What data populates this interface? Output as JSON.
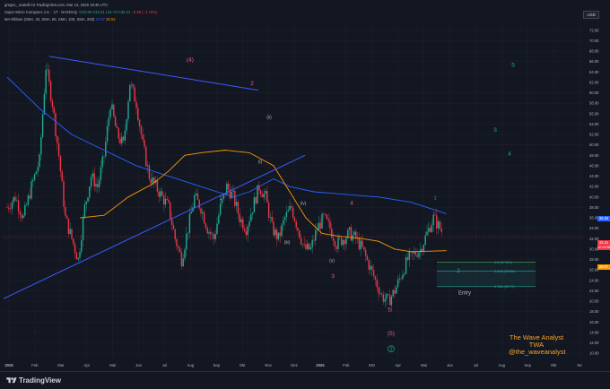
{
  "header": {
    "line1": "gregsc_ aratelli int TradingView.com, Mar 13, 2026 18:46 UTC",
    "symbol": "Super Micro Computer, Inc. · 1T · NASDAQ",
    "ohlc_o": "O32.90",
    "ohlc_h": "H33.21",
    "ohlc_l": "L31.73",
    "ohlc_c": "C32.41",
    "change": "−0.58 (−1.76%)",
    "ma_label": "MA Ribbon (SMA, 20, SMA, 50, SMA, 100, SMA, 200)",
    "ma_v1": "37.87",
    "ma_v2": "30.52"
  },
  "currency": "USD",
  "footer": {
    "brand": "TradingView"
  },
  "watermark": {
    "line1": "The Wave Analyst",
    "line2": "TWA",
    "line3": "@the_waveanalyst"
  },
  "price_labels": {
    "ma_blue": "36.83",
    "last": "32.41",
    "last_sub": "12:13:28",
    "ma_orange": "29.67"
  },
  "fib_labels": [
    "0.5 (27.5%)",
    "0.618 (25.83)",
    "0.786 (22.77)"
  ],
  "entry_label": "Entry",
  "wave_labels": [
    "(4)",
    "2",
    "(ii)",
    "(i)",
    "(iii)",
    "(iv)",
    "(v)",
    "1",
    "4",
    "3",
    "5",
    "(5)",
    "2",
    "1",
    "2",
    "3",
    "4",
    "5"
  ],
  "colors": {
    "bg": "#131722",
    "up": "#22ab94",
    "down": "#f23645",
    "ma_blue": "#2962ff",
    "ma_orange": "#ff9800",
    "label_pink": "#e85a9a",
    "label_teal": "#26a69a",
    "label_white": "#b2b5be",
    "watermark": "#f5a623"
  },
  "chart_data": {
    "type": "candlestick",
    "y_axis_labels": [
      "72.00",
      "70.00",
      "68.00",
      "66.00",
      "64.00",
      "62.00",
      "60.00",
      "58.00",
      "56.00",
      "54.00",
      "52.00",
      "50.00",
      "48.00",
      "46.00",
      "44.00",
      "42.00",
      "40.00",
      "38.00",
      "36.00",
      "34.00",
      "32.00",
      "30.00",
      "28.00",
      "26.00",
      "24.00",
      "22.00",
      "20.00",
      "18.00",
      "16.00",
      "14.00",
      "12.00",
      "10.00"
    ],
    "x_axis_labels": [
      "2025",
      "Feb",
      "Mar",
      "Apr",
      "Mai",
      "Jun",
      "Jul",
      "Aug",
      "Sep",
      "Okt",
      "Nov",
      "Dez",
      "2026",
      "Feb",
      "Mrz",
      "Apr",
      "Mai",
      "Jun",
      "Jul",
      "Aug",
      "Sep",
      "Okt",
      "Nv"
    ],
    "ylim": [
      9,
      73
    ],
    "ohlc_path": [
      [
        0,
        38
      ],
      [
        5,
        40
      ],
      [
        10,
        36
      ],
      [
        15,
        42
      ],
      [
        20,
        47
      ],
      [
        24,
        65
      ],
      [
        28,
        58
      ],
      [
        32,
        48
      ],
      [
        36,
        36
      ],
      [
        40,
        32
      ],
      [
        44,
        28
      ],
      [
        48,
        38
      ],
      [
        52,
        44
      ],
      [
        56,
        42
      ],
      [
        60,
        48
      ],
      [
        64,
        58
      ],
      [
        68,
        52
      ],
      [
        72,
        50
      ],
      [
        76,
        62
      ],
      [
        80,
        58
      ],
      [
        84,
        50
      ],
      [
        88,
        44
      ],
      [
        92,
        42
      ],
      [
        96,
        40
      ],
      [
        100,
        38
      ],
      [
        104,
        32
      ],
      [
        108,
        28
      ],
      [
        112,
        34
      ],
      [
        116,
        40
      ],
      [
        120,
        38
      ],
      [
        124,
        34
      ],
      [
        128,
        32
      ],
      [
        132,
        38
      ],
      [
        136,
        42
      ],
      [
        140,
        40
      ],
      [
        144,
        36
      ],
      [
        148,
        34
      ],
      [
        152,
        38
      ],
      [
        156,
        42
      ],
      [
        160,
        40
      ],
      [
        164,
        34
      ],
      [
        168,
        32
      ],
      [
        172,
        36
      ],
      [
        176,
        38
      ],
      [
        180,
        34
      ],
      [
        184,
        30
      ],
      [
        188,
        30
      ],
      [
        192,
        34
      ],
      [
        196,
        36
      ],
      [
        200,
        34
      ],
      [
        204,
        31
      ],
      [
        208,
        32
      ],
      [
        212,
        33
      ],
      [
        216,
        32
      ],
      [
        220,
        30
      ],
      [
        224,
        27
      ],
      [
        228,
        24
      ],
      [
        232,
        21
      ],
      [
        236,
        20
      ],
      [
        240,
        22
      ],
      [
        244,
        25
      ],
      [
        248,
        28
      ],
      [
        252,
        29
      ],
      [
        256,
        30
      ],
      [
        260,
        33
      ],
      [
        264,
        36
      ],
      [
        268,
        34
      ],
      [
        272,
        32
      ]
    ]
  }
}
